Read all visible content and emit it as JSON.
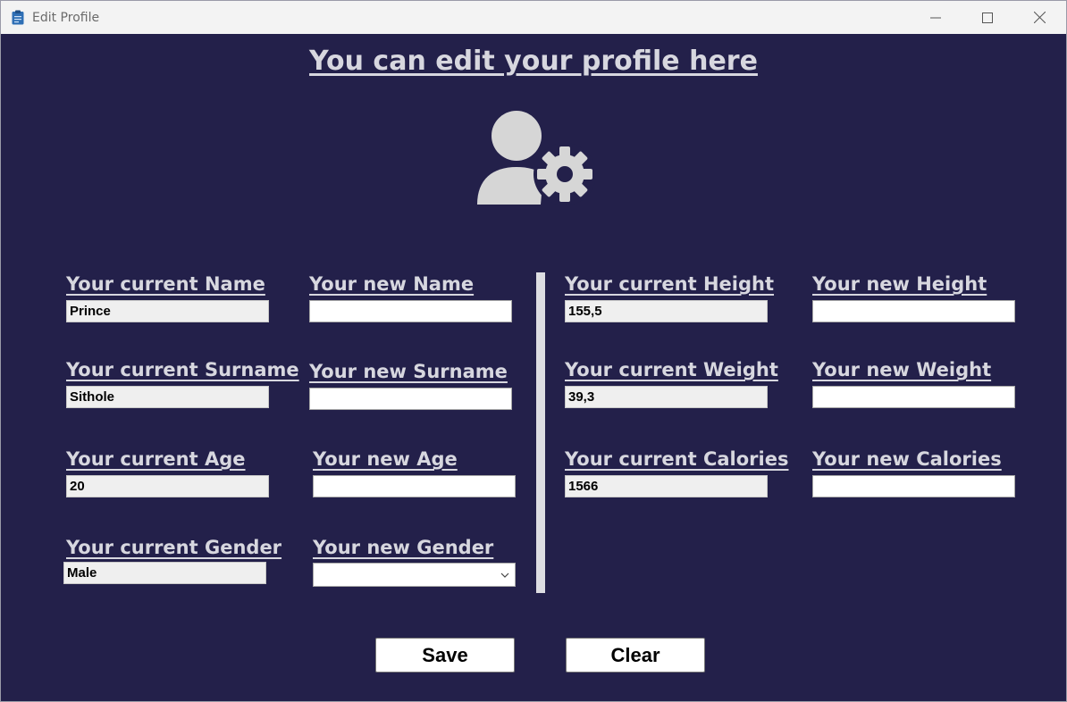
{
  "window": {
    "title": "Edit Profile"
  },
  "header": {
    "heading": "You can edit your profile here"
  },
  "fields": {
    "name": {
      "current_label": "Your current Name",
      "current_value": "Prince",
      "new_label": "Your new Name",
      "new_value": ""
    },
    "surname": {
      "current_label": "Your current Surname",
      "current_value": "Sithole",
      "new_label": "Your new Surname",
      "new_value": ""
    },
    "age": {
      "current_label": "Your current Age",
      "current_value": "20",
      "new_label": "Your new Age",
      "new_value": ""
    },
    "gender": {
      "current_label": "Your current Gender",
      "current_value": "Male",
      "new_label": "Your new Gender",
      "new_value": ""
    },
    "height": {
      "current_label": "Your current Height",
      "current_value": "155,5",
      "new_label": "Your new Height",
      "new_value": ""
    },
    "weight": {
      "current_label": "Your current Weight",
      "current_value": "39,3",
      "new_label": "Your new Weight",
      "new_value": ""
    },
    "calories": {
      "current_label": "Your current Calories",
      "current_value": "1566",
      "new_label": "Your new Calories",
      "new_value": ""
    }
  },
  "actions": {
    "save_label": "Save",
    "clear_label": "Clear"
  },
  "colors": {
    "background": "#23204a",
    "label": "#d7d7df",
    "titlebar": "#f3f3f3",
    "divider": "#dddde2"
  },
  "icons": {
    "app": "clipboard-icon",
    "hero": "user-settings-icon",
    "dropdown": "chevron-down-icon"
  }
}
